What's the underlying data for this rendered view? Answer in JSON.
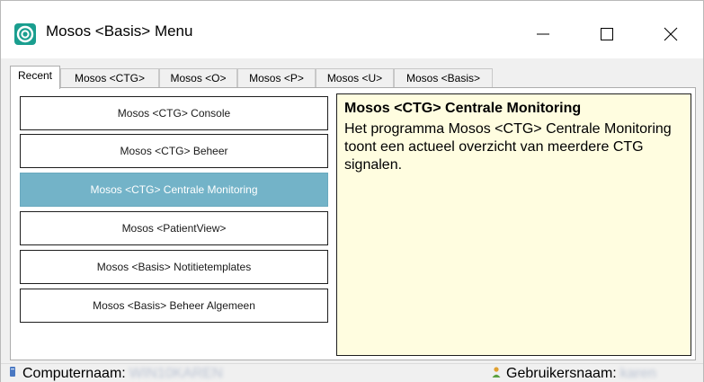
{
  "window": {
    "title": "Mosos <Basis> Menu",
    "icon": "mosos-logo-icon",
    "controls": {
      "minimize_icon": "minimize-icon",
      "maximize_icon": "maximize-icon",
      "close_icon": "close-icon"
    }
  },
  "tabs": [
    {
      "label": "Recent",
      "active": true
    },
    {
      "label": "Mosos <CTG>"
    },
    {
      "label": "Mosos <O>"
    },
    {
      "label": "Mosos <P>"
    },
    {
      "label": "Mosos <U>"
    },
    {
      "label": "Mosos <Basis>"
    }
  ],
  "programs": [
    {
      "label": "Mosos <CTG> Console"
    },
    {
      "label": "Mosos <CTG> Beheer"
    },
    {
      "label": "Mosos <CTG> Centrale Monitoring",
      "selected": true
    },
    {
      "label": "Mosos <PatientView>"
    },
    {
      "label": "Mosos <Basis> Notitietemplates"
    },
    {
      "label": "Mosos <Basis> Beheer Algemeen"
    }
  ],
  "description": {
    "title": "Mosos <CTG> Centrale Monitoring",
    "text": "Het programma Mosos <CTG> Centrale Monitoring toont een actueel overzicht van meerdere CTG signalen."
  },
  "status": {
    "computer_label": "Computernaam:",
    "computer_value": "WIN10KAREN",
    "computer_icon": "computer-icon",
    "user_label": "Gebruikersnaam:",
    "user_value": "karen",
    "user_icon": "user-icon"
  },
  "colors": {
    "selected_button": "#73b3c8",
    "description_background": "#fffde0",
    "brand": "#1a9e8f"
  }
}
